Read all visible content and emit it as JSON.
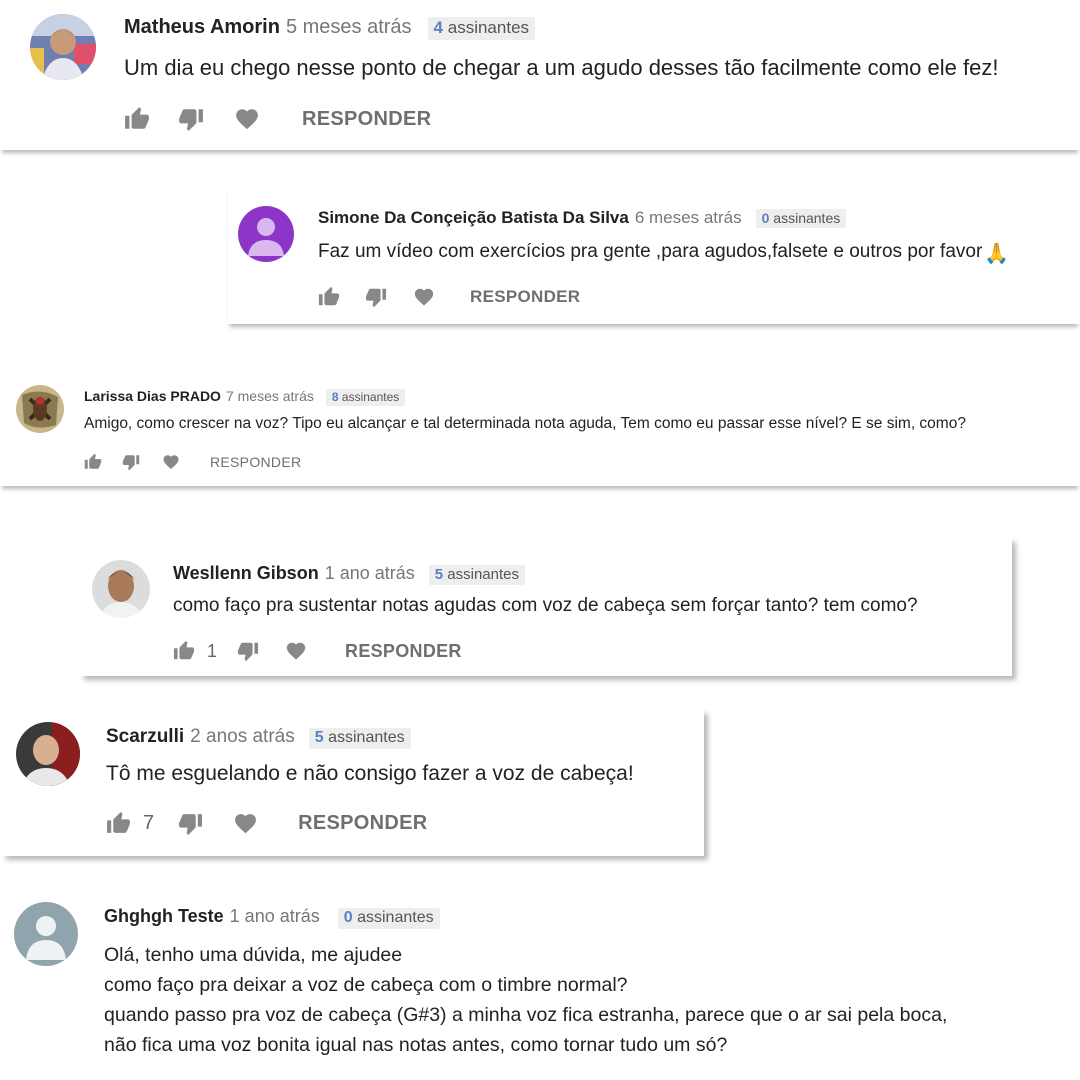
{
  "comments": [
    {
      "author": "Matheus Amorin",
      "time": "5 meses atrás",
      "subs_count": "4",
      "subs_label": "assinantes",
      "text": "Um dia eu chego nesse ponto de chegar a um agudo desses tão facilmente como ele fez!",
      "like_count": "",
      "reply_label": "RESPONDER",
      "avatar": "photo-avatar"
    },
    {
      "author": "Simone Da Conçeição Batista Da Silva",
      "time": "6 meses atrás",
      "subs_count": "0",
      "subs_label": "assinantes",
      "text": "Faz um vídeo com exercícios pra gente ,para agudos,falsete e outros por favor",
      "emoji": "🙏",
      "like_count": "",
      "reply_label": "RESPONDER",
      "avatar": "default-avatar-purple"
    },
    {
      "author": "Larissa Dias PRADO",
      "time": "7 meses atrás",
      "subs_count": "8",
      "subs_label": "assinantes",
      "text": "Amigo,  como crescer na voz? Tipo eu alcançar e tal determinada nota aguda,  Tem como eu passar esse nível?  E se sim,  como?",
      "like_count": "",
      "reply_label": "RESPONDER",
      "avatar": "photo-avatar"
    },
    {
      "author": "Wesllenn Gibson",
      "time": "1 ano atrás",
      "subs_count": "5",
      "subs_label": "assinantes",
      "text": "como faço pra sustentar notas agudas com voz de cabeça sem forçar tanto? tem como?",
      "like_count": "1",
      "reply_label": "RESPONDER",
      "avatar": "photo-avatar"
    },
    {
      "author": "Scarzulli",
      "time": "2 anos atrás",
      "subs_count": "5",
      "subs_label": "assinantes",
      "text": "Tô me esguelando e não consigo fazer a voz de cabeça!",
      "like_count": "7",
      "reply_label": "RESPONDER",
      "avatar": "photo-avatar"
    },
    {
      "author": "Ghghgh Teste",
      "time": "1 ano atrás",
      "subs_count": "0",
      "subs_label": "assinantes",
      "lines": [
        "Olá, tenho uma dúvida, me ajudee",
        "como faço pra deixar a voz de cabeça com o timbre normal?",
        "quando passo pra voz de cabeça  (G#3)  a minha voz fica estranha, parece que o ar sai pela boca,",
        "não fica uma voz bonita igual  nas notas antes, como tornar tudo um só?"
      ],
      "avatar": "default-avatar-grey"
    }
  ],
  "icons": [
    "thumbs-up-icon",
    "thumbs-down-icon",
    "heart-icon"
  ],
  "colors": {
    "author": "#222222",
    "time": "#777777",
    "subs_badge_bg": "#eeeeee",
    "subs_count": "#5a7fc4",
    "action_icon": "#888888",
    "reply": "#6f6f6f",
    "default_avatar_purple": "#8e35c9",
    "default_avatar_grey": "#90a4ae"
  }
}
